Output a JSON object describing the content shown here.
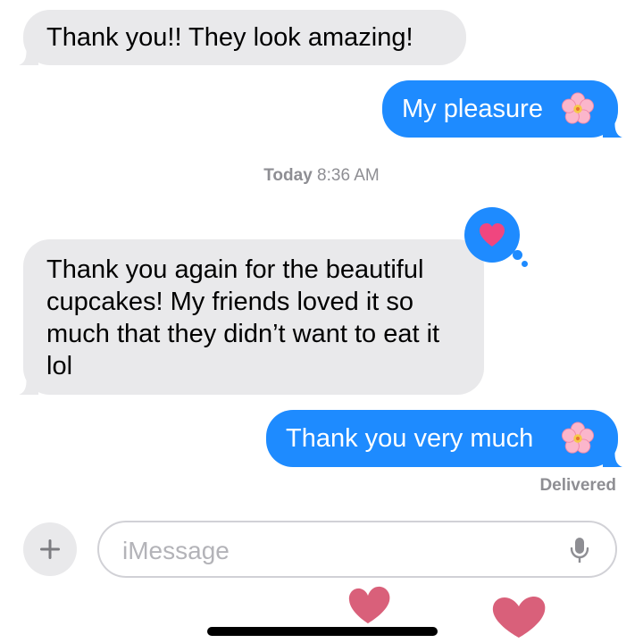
{
  "messages": [
    {
      "direction": "incoming",
      "text": "Thank you!! They look amazing!"
    },
    {
      "direction": "outgoing",
      "text": "My pleasure",
      "emoji": "cherry-blossom-icon"
    },
    {
      "direction": "incoming",
      "text": "Thank you again for the beautiful cupcakes! My friends loved it so much that they didn’t want to eat it lol",
      "reaction": "heart-icon"
    },
    {
      "direction": "outgoing",
      "text": "Thank you very much",
      "emoji": "cherry-blossom-icon"
    }
  ],
  "timestamp": {
    "day": "Today",
    "time": "8:36 AM"
  },
  "delivery_status": "Delivered",
  "composer": {
    "placeholder": "iMessage",
    "add_icon": "plus-icon",
    "mic_icon": "microphone-icon"
  },
  "decorations": [
    "pink-heart-sticker",
    "pink-heart-sticker"
  ],
  "colors": {
    "outgoing_bubble": "#1e8bff",
    "incoming_bubble": "#e9e9eb",
    "reaction_heart": "#f0467f",
    "sticker_heart": "#d9607a",
    "secondary_text": "#8e8e93"
  }
}
